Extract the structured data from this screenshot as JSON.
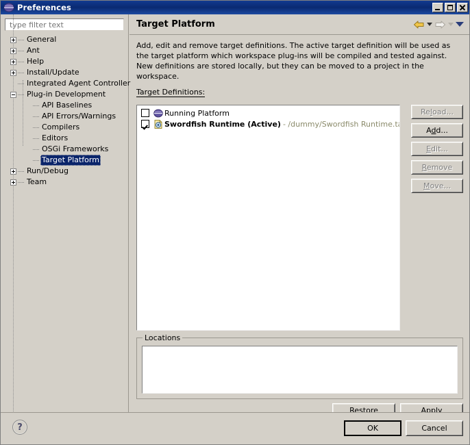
{
  "window": {
    "title": "Preferences",
    "icon": "eclipse-globe-icon",
    "minimize_label": "",
    "maximize_label": "",
    "close_label": ""
  },
  "sidebar": {
    "filter": {
      "placeholder": "type filter text",
      "value": ""
    },
    "items": [
      {
        "label": "General",
        "state": "collapsed",
        "level": 0
      },
      {
        "label": "Ant",
        "state": "collapsed",
        "level": 0
      },
      {
        "label": "Help",
        "state": "collapsed",
        "level": 0
      },
      {
        "label": "Install/Update",
        "state": "collapsed",
        "level": 0
      },
      {
        "label": "Integrated Agent Controller",
        "state": "leaf",
        "level": 0
      },
      {
        "label": "Plug-in Development",
        "state": "expanded",
        "level": 0
      },
      {
        "label": "API Baselines",
        "state": "leaf",
        "level": 1
      },
      {
        "label": "API Errors/Warnings",
        "state": "leaf",
        "level": 1
      },
      {
        "label": "Compilers",
        "state": "leaf",
        "level": 1
      },
      {
        "label": "Editors",
        "state": "leaf",
        "level": 1
      },
      {
        "label": "OSGi Frameworks",
        "state": "leaf",
        "level": 1
      },
      {
        "label": "Target Platform",
        "state": "leaf",
        "level": 1,
        "selected": true
      },
      {
        "label": "Run/Debug",
        "state": "collapsed",
        "level": 0
      },
      {
        "label": "Team",
        "state": "collapsed",
        "level": 0
      }
    ],
    "selected": "Target Platform"
  },
  "page": {
    "title": "Target Platform",
    "description": "Add, edit and remove target definitions.  The active target definition will be used as the target platform which workspace plug-ins will be compiled and tested against.  New definitions are stored locally, but they can be moved to a project in the workspace.",
    "nav": {
      "back_icon": "back-arrow-icon",
      "back_dropdown_icon": "chevron-down-icon",
      "forward_icon": "forward-arrow-icon",
      "forward_dropdown_icon": "chevron-down-icon",
      "menu_icon": "chevron-down-icon"
    },
    "target_definitions_label": "Target Definitions:",
    "target_definitions": [
      {
        "name": "Running Platform",
        "checked": false,
        "bold": false,
        "path": "",
        "icon": "running-platform-icon"
      },
      {
        "name": "Swordfish Runtime (Active)",
        "checked": true,
        "bold": true,
        "path": "- /dummy/Swordfish Runtime.target",
        "icon": "target-definition-icon"
      }
    ],
    "side_buttons": [
      {
        "label": "Reload...",
        "enabled": false,
        "mnemonic": "l"
      },
      {
        "label": "Add...",
        "enabled": true,
        "mnemonic": "d"
      },
      {
        "label": "Edit...",
        "enabled": false,
        "mnemonic": "E"
      },
      {
        "label": "Remove",
        "enabled": false,
        "mnemonic": "R"
      },
      {
        "label": "Move...",
        "enabled": false,
        "mnemonic": "M"
      }
    ],
    "locations": {
      "legend": "Locations",
      "items": []
    },
    "restore_defaults_label": "Restore Defaults",
    "apply_label": "Apply"
  },
  "footer": {
    "help_label": "?",
    "ok_label": "OK",
    "cancel_label": "Cancel"
  },
  "colors": {
    "titlebar": "#0a2a72",
    "dialog_bg": "#d4d0c8",
    "selection": "#0a246a",
    "path_text": "#8a8a6a",
    "disabled_text": "#808080",
    "back_arrow": "#e8b73a"
  }
}
